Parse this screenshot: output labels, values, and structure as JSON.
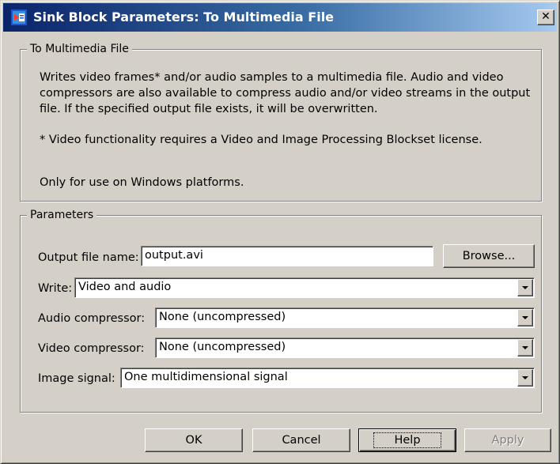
{
  "window": {
    "title": "Sink Block Parameters: To Multimedia File",
    "close_glyph": "✕",
    "icon": "simulink-block-icon"
  },
  "description_group": {
    "legend": "To Multimedia File",
    "paragraph1": "Writes video frames* and/or audio samples to a multimedia file.  Audio and video compressors are also available to compress audio and/or video streams in the output file.  If the specified output file exists, it will be overwritten.",
    "paragraph2": "* Video functionality requires a Video and Image Processing Blockset license.",
    "paragraph3": "Only for use on Windows platforms."
  },
  "parameters_group": {
    "legend": "Parameters",
    "output_file": {
      "label": "Output file name:",
      "value": "output.avi"
    },
    "browse_label": "Browse...",
    "write": {
      "label": "Write:",
      "value": "Video and audio"
    },
    "audio_compressor": {
      "label": "Audio compressor:",
      "value": "None (uncompressed)"
    },
    "video_compressor": {
      "label": "Video compressor:",
      "value": "None (uncompressed)"
    },
    "image_signal": {
      "label": "Image signal:",
      "value": "One multidimensional signal"
    }
  },
  "buttons": {
    "ok": "OK",
    "cancel": "Cancel",
    "help": "Help",
    "apply": "Apply"
  },
  "colors": {
    "dialog_face": "#d4d0c8",
    "title_bar_start": "#0a246a",
    "title_bar_end": "#a6caf0",
    "disabled_text": "#808080"
  }
}
